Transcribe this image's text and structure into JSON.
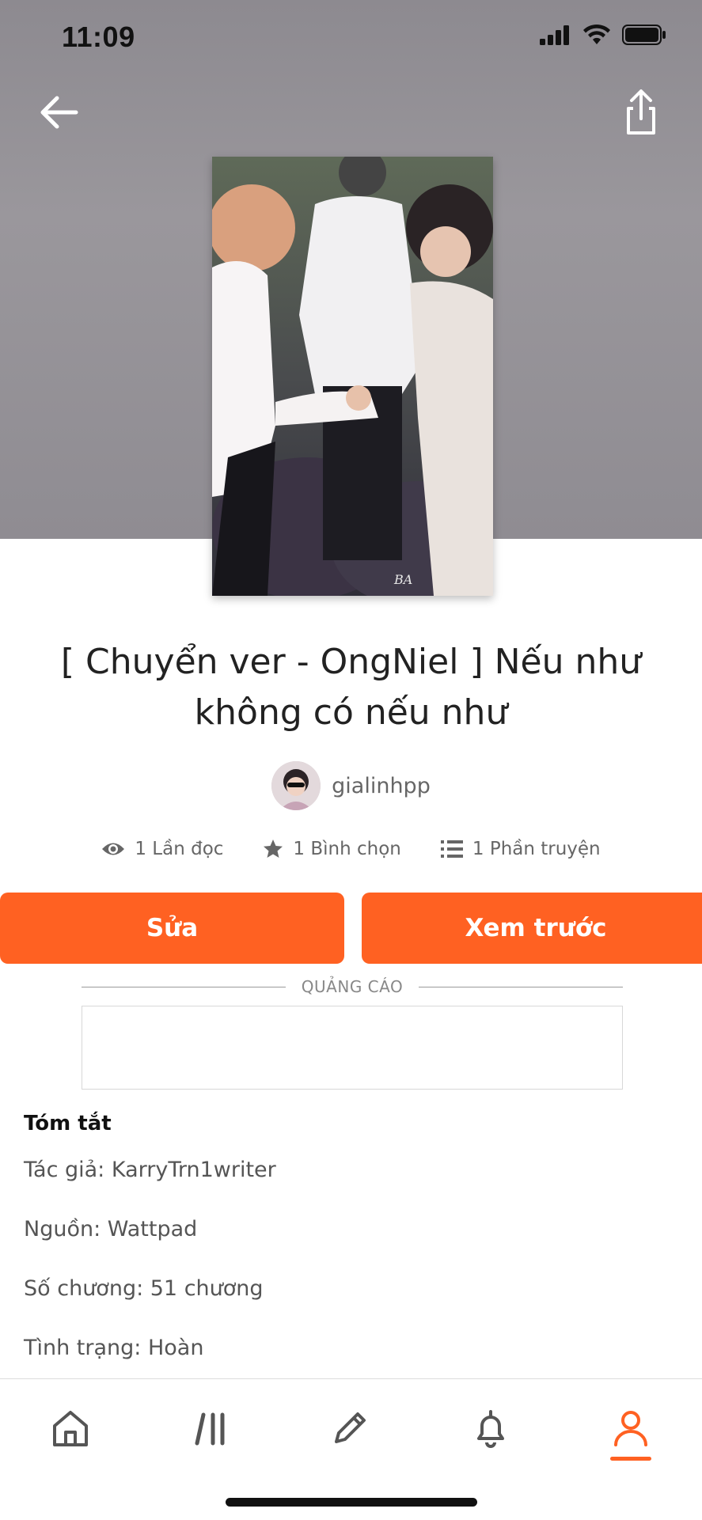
{
  "status_bar": {
    "time": "11:09"
  },
  "story": {
    "title": "[ Chuyển ver - OngNiel ] Nếu như không có nếu như",
    "author": "gialinhpp"
  },
  "stats": {
    "reads": "1 Lần đọc",
    "votes": "1 Bình chọn",
    "parts": "1 Phần truyện"
  },
  "actions": {
    "edit_label": "Sửa",
    "preview_label": "Xem trước"
  },
  "ad": {
    "label": "QUẢNG CÁO"
  },
  "summary": {
    "heading": "Tóm tắt",
    "lines": [
      "Tác giả: KarryTrn1writer",
      "Nguồn: Wattpad",
      "Số chương: 51 chương",
      "Tình trạng: Hoàn"
    ]
  },
  "tabs": {
    "items": [
      {
        "name": "home",
        "icon": "home-icon"
      },
      {
        "name": "library",
        "icon": "library-icon"
      },
      {
        "name": "write",
        "icon": "pencil-icon"
      },
      {
        "name": "notifications",
        "icon": "bell-icon"
      },
      {
        "name": "profile",
        "icon": "person-icon",
        "active": true
      }
    ]
  },
  "colors": {
    "accent": "#ff6122",
    "hero_bg": "#938f95"
  }
}
